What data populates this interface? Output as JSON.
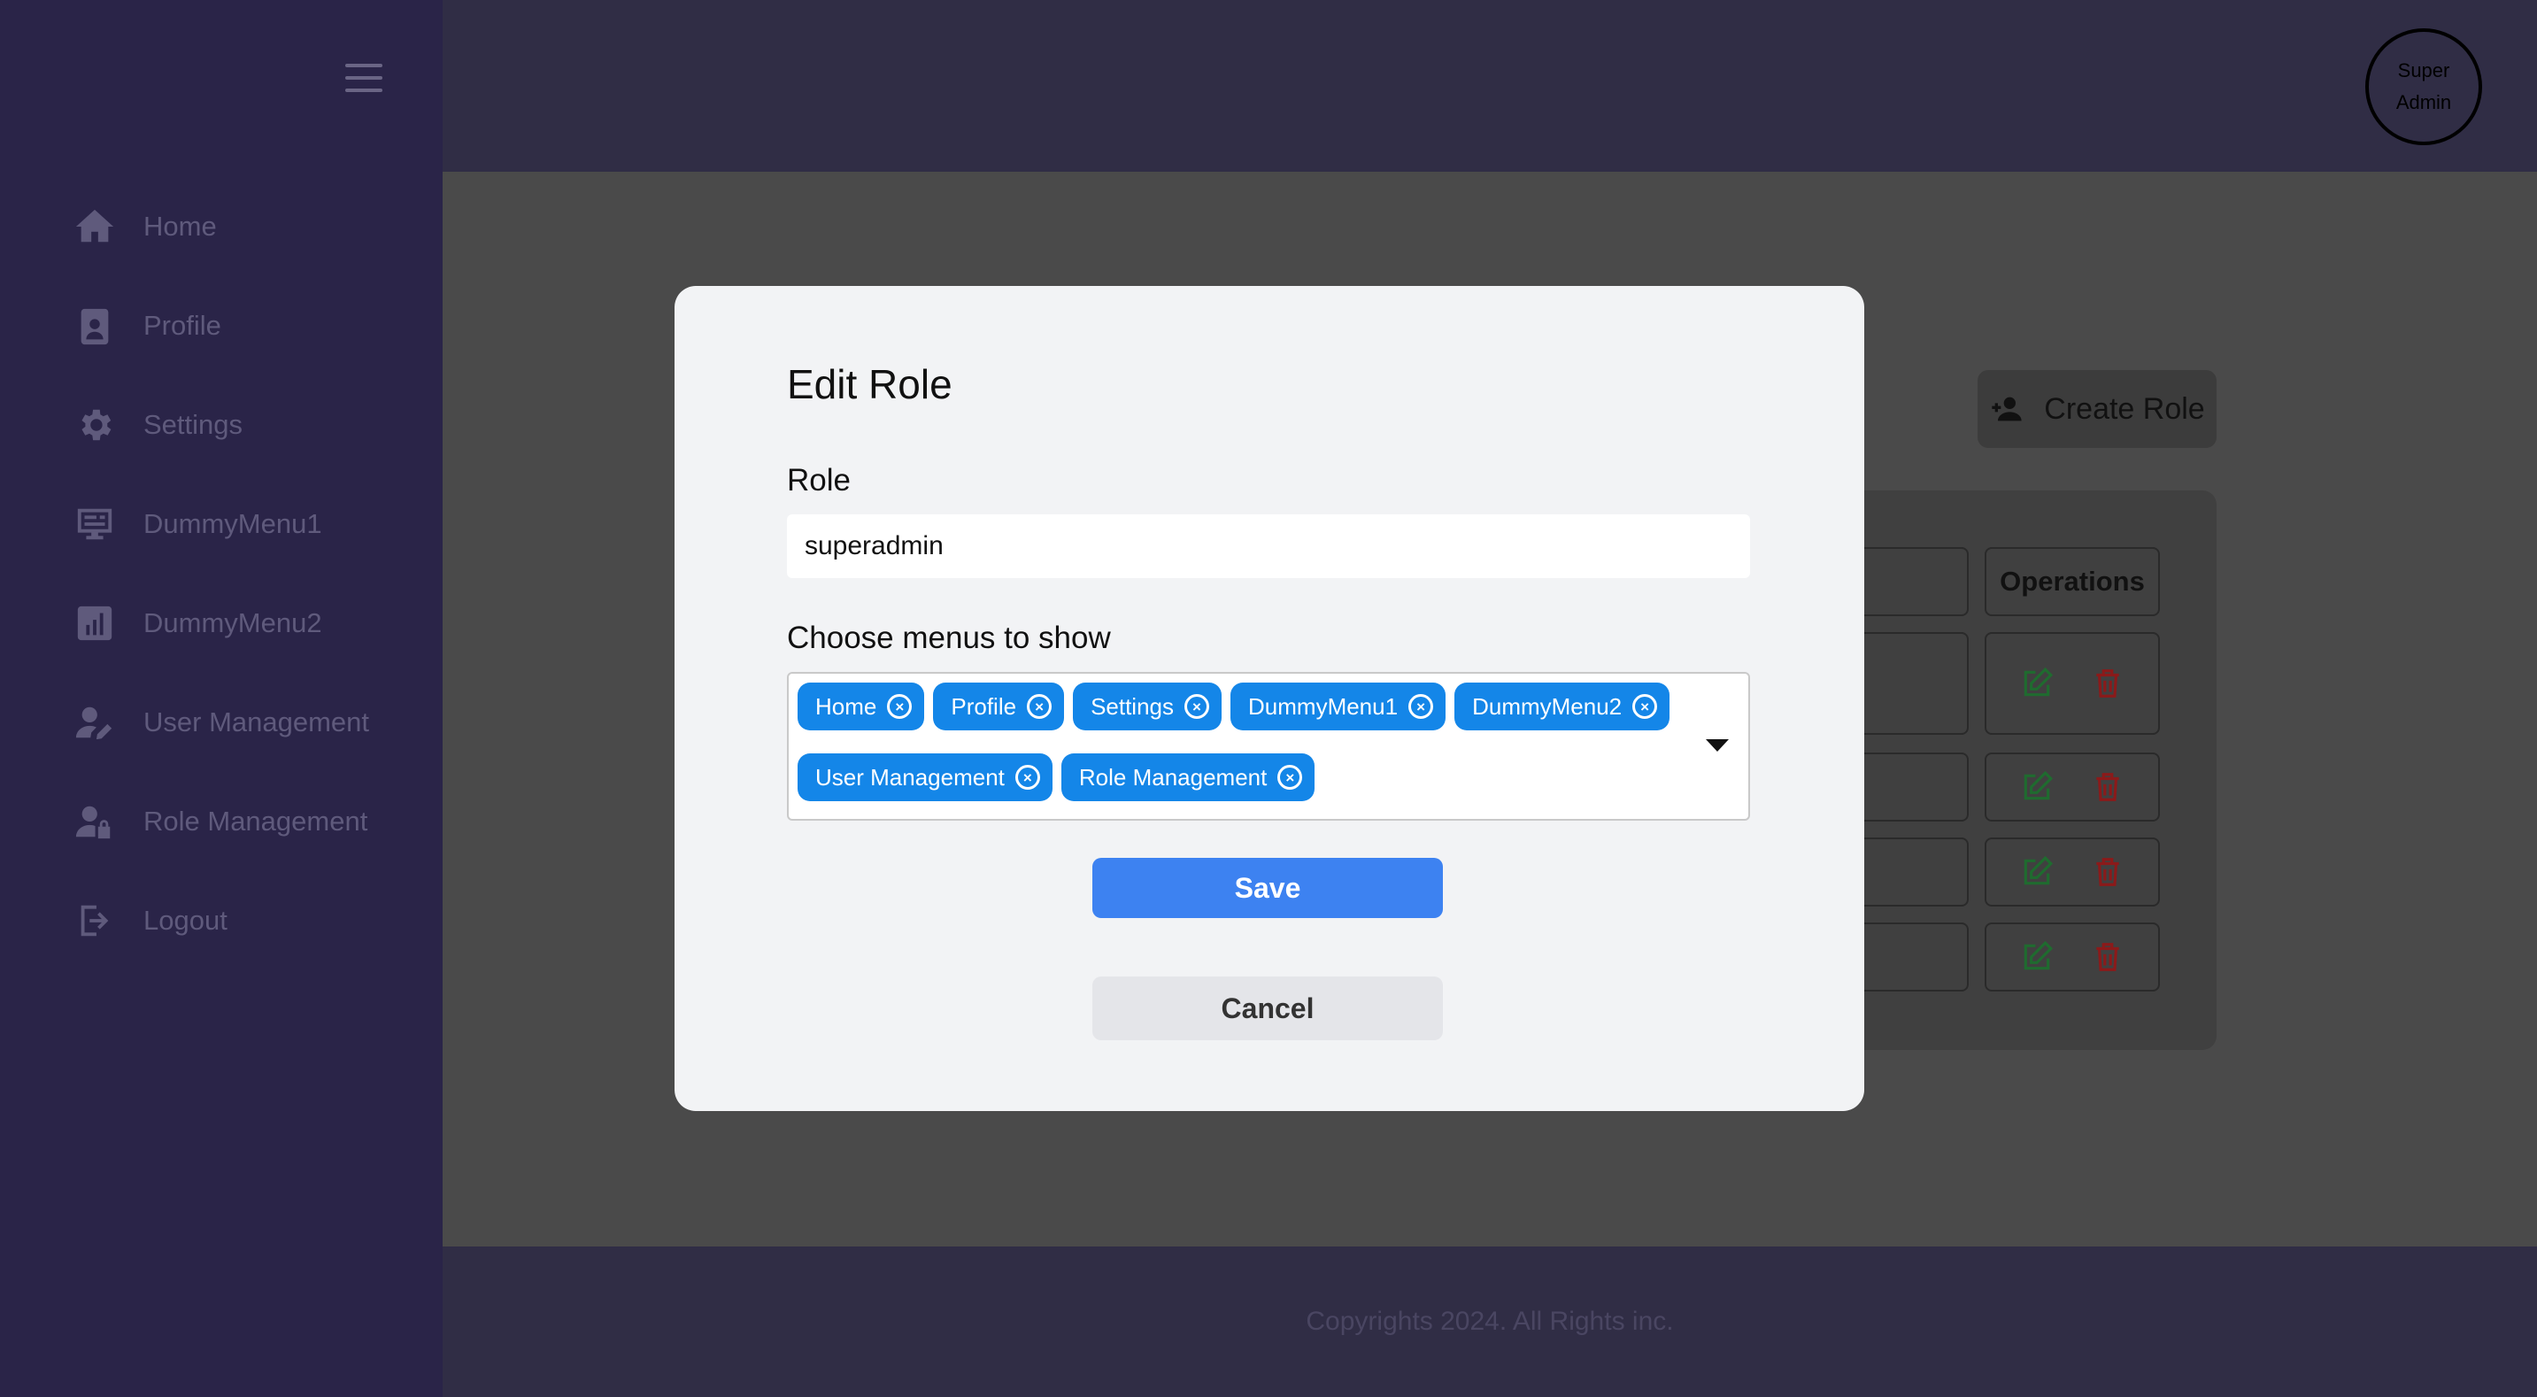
{
  "sidebar": {
    "items": [
      {
        "label": "Home",
        "icon": "home-icon"
      },
      {
        "label": "Profile",
        "icon": "profile-badge-icon"
      },
      {
        "label": "Settings",
        "icon": "gear-icon"
      },
      {
        "label": "DummyMenu1",
        "icon": "monitor-icon"
      },
      {
        "label": "DummyMenu2",
        "icon": "chart-icon"
      },
      {
        "label": "User Management",
        "icon": "user-edit-icon"
      },
      {
        "label": "Role Management",
        "icon": "user-lock-icon"
      },
      {
        "label": "Logout",
        "icon": "logout-icon"
      }
    ]
  },
  "header": {
    "avatar_line1": "Super",
    "avatar_line2": "Admin"
  },
  "page": {
    "create_role_label": "Create Role",
    "table_header_operations": "Operations"
  },
  "modal": {
    "title": "Edit Role",
    "role_label": "Role",
    "role_value": "superadmin",
    "menus_label": "Choose menus to show",
    "selected_menus": [
      "Home",
      "Profile",
      "Settings",
      "DummyMenu1",
      "DummyMenu2",
      "User Management",
      "Role Management"
    ],
    "save_label": "Save",
    "cancel_label": "Cancel"
  },
  "footer": {
    "copyright": "Copyrights 2024. All Rights inc."
  },
  "colors": {
    "sidebar_bg": "#2a2448",
    "topbar_bg": "#302d45",
    "chip": "#1486e8",
    "save_button": "#3d82f1",
    "edit_icon": "#1f6b2f",
    "delete_icon": "#8b1a1a"
  }
}
